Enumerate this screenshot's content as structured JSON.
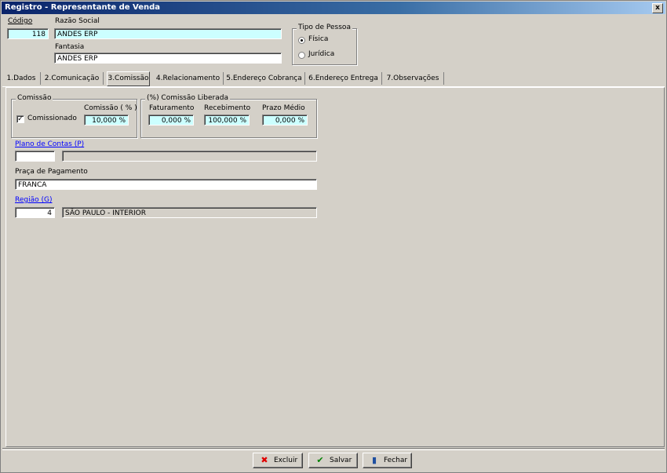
{
  "window": {
    "title": "Registro - Representante de Venda",
    "close_label": "x"
  },
  "header": {
    "codigo_label": "Código",
    "codigo_value": "118",
    "razao_label": "Razão Social",
    "razao_value": "ANDES ERP",
    "fantasia_label": "Fantasia",
    "fantasia_value": "ANDES ERP",
    "tipo_pessoa": {
      "title": "Tipo de Pessoa",
      "fisica": "Física",
      "juridica": "Jurídica",
      "selected": "fisica"
    }
  },
  "tabs": [
    {
      "label": "1.Dados"
    },
    {
      "label": "2.Comunicação"
    },
    {
      "label": "3.Comissão"
    },
    {
      "label": "4.Relacionamento"
    },
    {
      "label": "5.Endereço Cobrança"
    },
    {
      "label": "6.Endereço Entrega"
    },
    {
      "label": "7.Observações"
    }
  ],
  "active_tab": "3.Comissão",
  "comissao": {
    "group_title": "Comissão",
    "comissionado_label": "Comissionado",
    "comissionado_checked": true,
    "pct_label": "Comissão ( % )",
    "pct_value": "10,000 %"
  },
  "liberada": {
    "group_title": "(%) Comissão Liberada",
    "faturamento_label": "Faturamento",
    "faturamento_value": "0,000 %",
    "recebimento_label": "Recebimento",
    "recebimento_value": "100,000 %",
    "prazo_label": "Prazo Médio",
    "prazo_value": "0,000 %"
  },
  "plano_contas": {
    "label": "Plano de Contas (P)",
    "code": "",
    "description": ""
  },
  "praca": {
    "label": "Praça de Pagamento",
    "value": "FRANCA"
  },
  "regiao": {
    "label": "Região (G)",
    "code": "4",
    "description": "SÃO PAULO - INTERIOR"
  },
  "buttons": {
    "excluir": "Excluir",
    "salvar": "Salvar",
    "fechar": "Fechar"
  }
}
